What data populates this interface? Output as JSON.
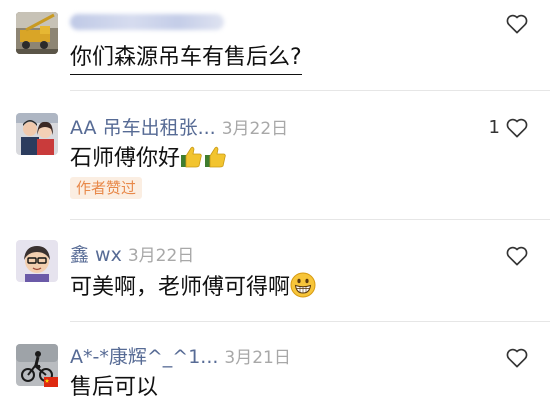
{
  "comments": [
    {
      "name": "",
      "date": "",
      "text": "你们森源吊车有售后么?",
      "likes": "",
      "badge": ""
    },
    {
      "name": "AA 吊车出租张...",
      "date": "3月22日",
      "text": "石师傅你好",
      "likes": "1",
      "badge": "作者赞过"
    },
    {
      "name": "鑫 wx",
      "date": "3月22日",
      "text": "可美啊，老师傅可得啊",
      "likes": "",
      "badge": ""
    },
    {
      "name": "A*-*康辉^_^1...",
      "date": "3月21日",
      "text": "售后可以",
      "likes": "",
      "badge": ""
    }
  ],
  "icons": {
    "like": "heart-outline-icon",
    "thumbs": "thumbs-up-emoji",
    "grin": "grinning-face-emoji",
    "flag": "china-flag-icon"
  },
  "colors": {
    "name": "#576b95",
    "date": "#a8a8a8",
    "badge_bg": "#fbeee2",
    "badge_text": "#e8894a"
  }
}
